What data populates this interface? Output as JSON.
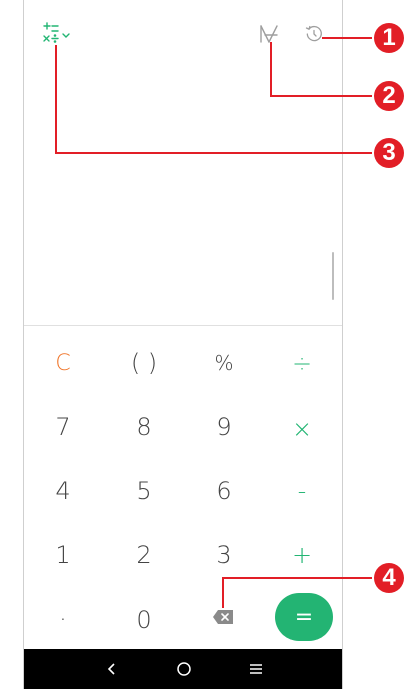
{
  "toolbar": {
    "converter_icon": "conversion-menu-icon",
    "unit_icon": "unit-conversion-icon",
    "history_icon": "history-icon",
    "accent_color": "#22b573"
  },
  "keypad": {
    "row1": {
      "clear": "C",
      "parens": "(   )",
      "percent": "%",
      "divide": "÷"
    },
    "row2": {
      "seven": "7",
      "eight": "8",
      "nine": "9",
      "multiply": "×"
    },
    "row3": {
      "four": "4",
      "five": "5",
      "six": "6",
      "minus": "-"
    },
    "row4": {
      "one": "1",
      "two": "2",
      "three": "3",
      "plus": "+"
    },
    "row5": {
      "decimal": ".",
      "zero": "0",
      "backspace_icon": "backspace-icon",
      "equals": "="
    }
  },
  "navigation": {
    "back": "‹",
    "home": "○",
    "recents": "≡"
  },
  "callouts": [
    "1",
    "2",
    "3",
    "4"
  ],
  "colors": {
    "clear": "#f0762b",
    "operator": "#22b573",
    "equals_bg": "#23b473",
    "callout": "#e21e26"
  }
}
